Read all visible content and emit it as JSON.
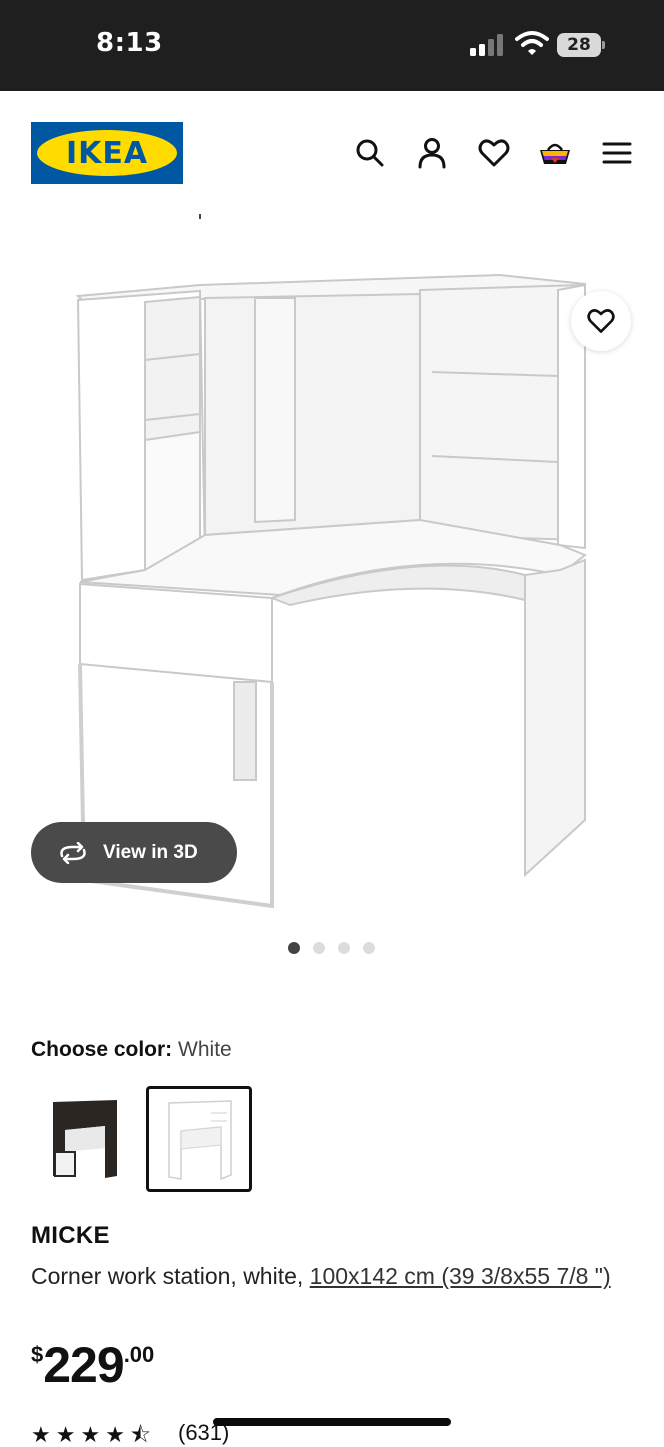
{
  "status": {
    "time": "8:13",
    "battery": "28"
  },
  "brand": {
    "logo_text": "IKEA"
  },
  "product": {
    "color_label": "Choose color:",
    "color_value": "White",
    "name": "MICKE",
    "description_prefix": "Corner work station, white, ",
    "size_link": "100x142 cm (39 3/8x55 7/8 \")",
    "price_currency": "$",
    "price_int": "229",
    "price_dec": ".00",
    "rating": 4.5,
    "review_count": "(631)",
    "view_3d": "View in 3D",
    "carousel": {
      "total": 4,
      "active": 1
    }
  },
  "colors": {
    "accent_blue": "#0058a3",
    "accent_yellow": "#ffdb00"
  }
}
